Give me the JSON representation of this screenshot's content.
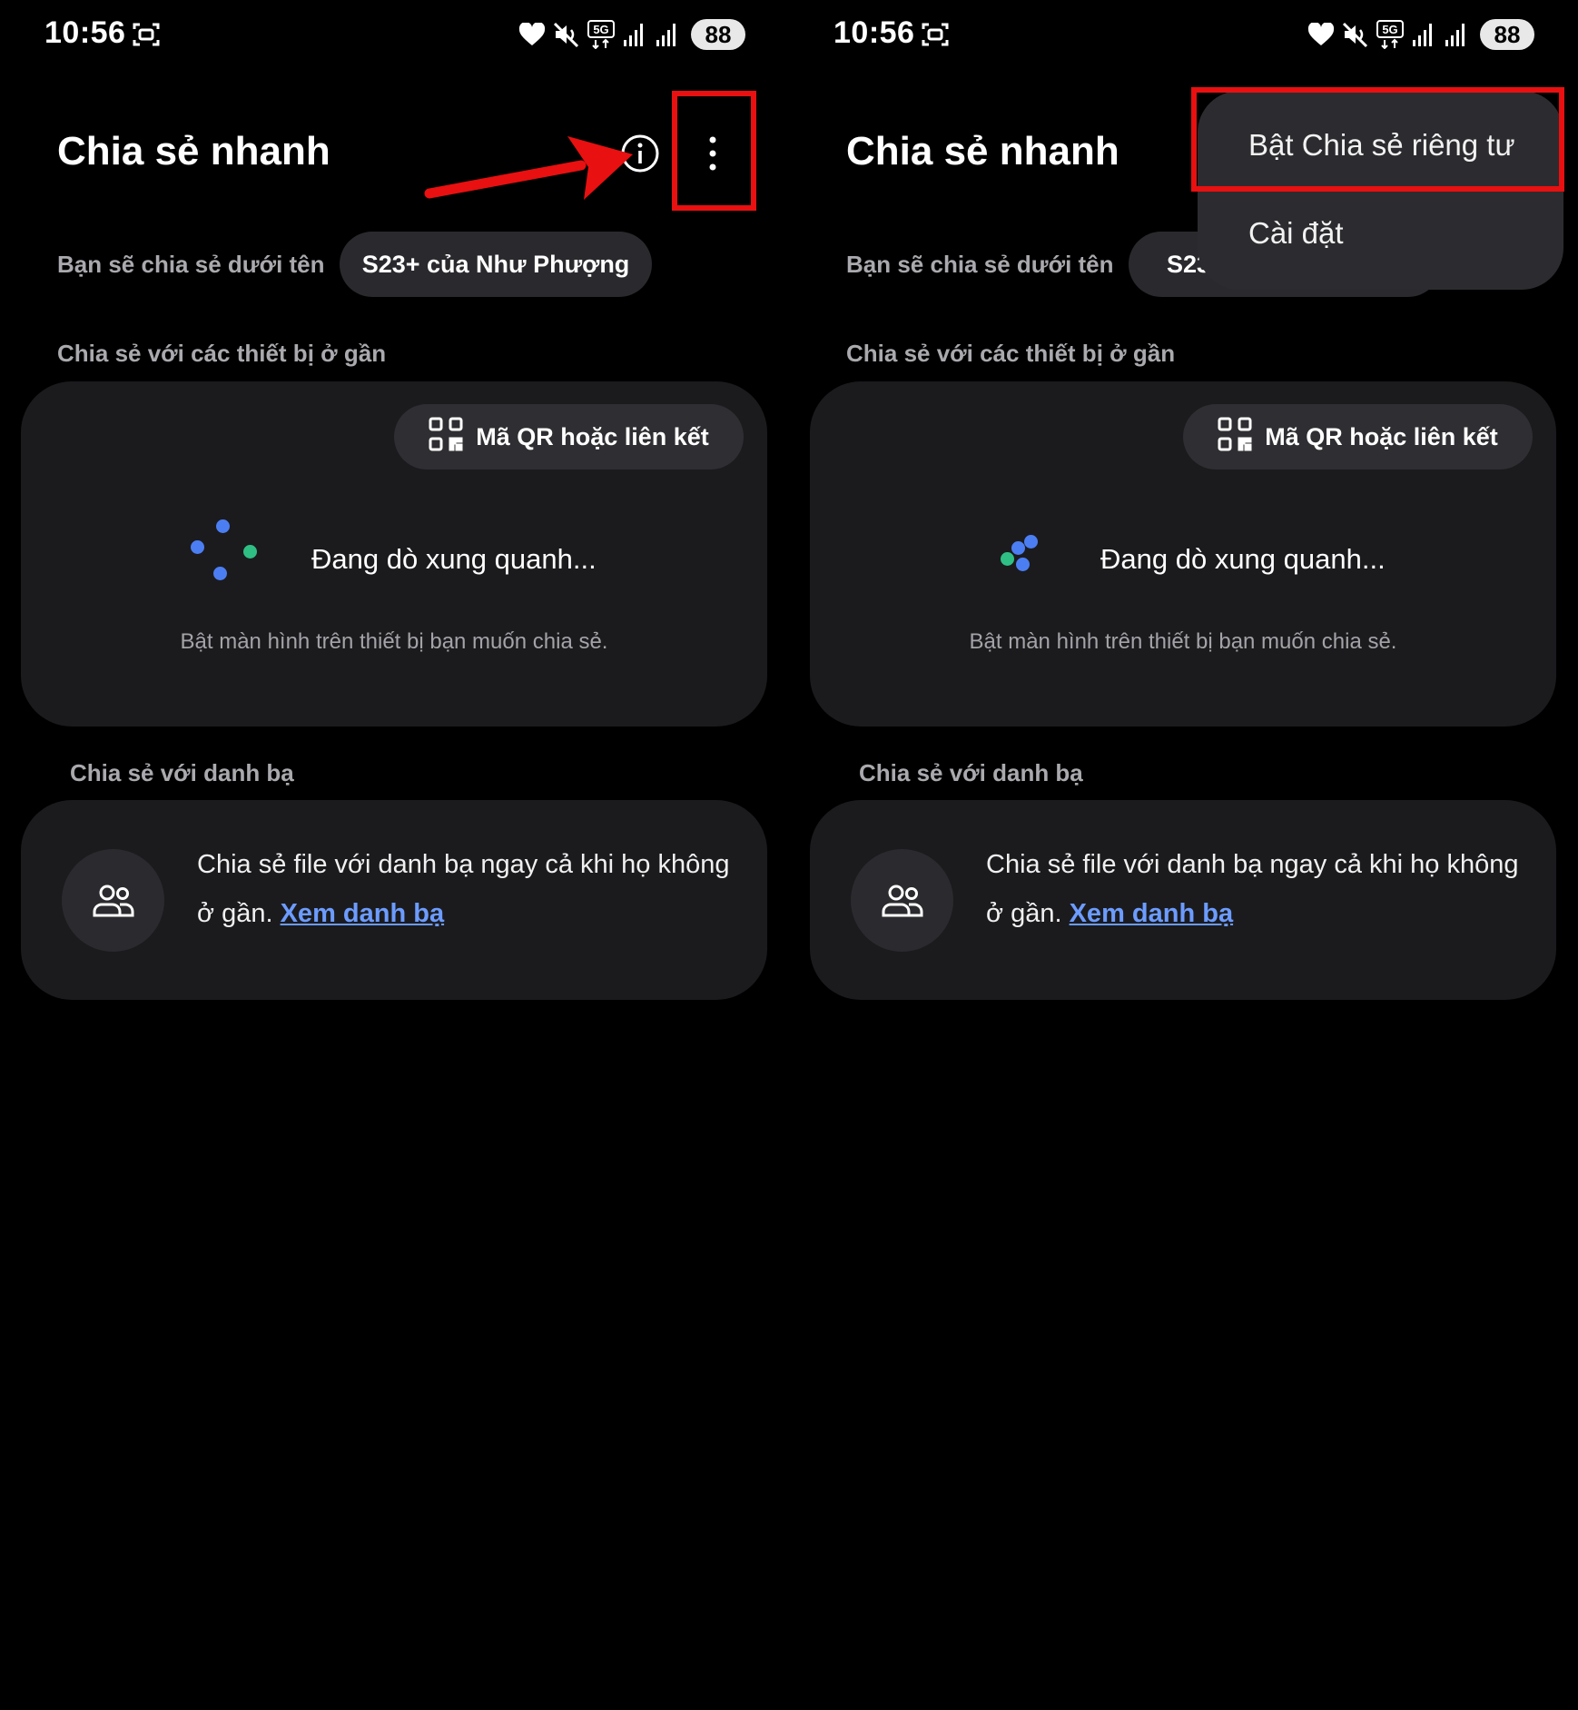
{
  "status_bar": {
    "time": "10:56",
    "network_label": "5G",
    "battery": "88"
  },
  "app": {
    "title": "Chia sẻ nhanh",
    "share_name_label": "Bạn sẽ chia sẻ dưới tên",
    "device_name": "S23+ của Như Phượng",
    "device_name_truncated": "S23",
    "nearby_heading": "Chia sẻ với các thiết bị ở gần",
    "qr_button_label": "Mã QR hoặc liên kết",
    "scanning_text": "Đang dò xung quanh...",
    "scanning_hint": "Bật màn hình trên thiết bị bạn muốn chia sẻ.",
    "contacts_heading": "Chia sẻ với danh bạ",
    "contacts_text": "Chia sẻ file với danh bạ ngay cả khi họ không ở gần.",
    "contacts_link": "Xem danh bạ"
  },
  "menu": {
    "items": [
      "Bật Chia sẻ riêng tư",
      "Cài đặt"
    ]
  },
  "icons": {
    "screenshot": "screenshot-icon",
    "heart": "heart-icon",
    "mute": "mute-icon",
    "signal": "signal-icon",
    "info": "info-icon",
    "more": "more-vert-icon",
    "qr": "qr-code-icon",
    "contacts": "contacts-icon"
  },
  "colors": {
    "background": "#000000",
    "card": "#1b1b1e",
    "chip": "#2a2a2e",
    "link": "#6c9cff",
    "dot_blue": "#4c7ef3",
    "dot_green": "#2fbf84",
    "annotation_red": "#e81010"
  }
}
